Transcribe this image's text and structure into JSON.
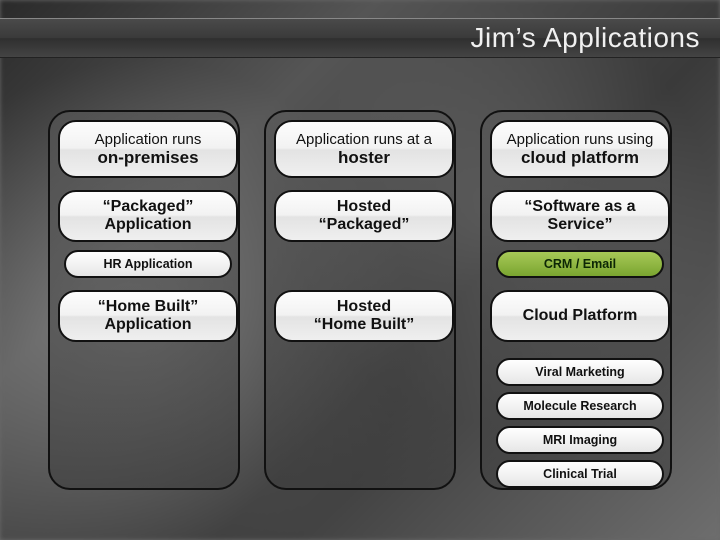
{
  "title": "Jim’s Applications",
  "columns": [
    {
      "header_line1": "Application runs",
      "header_line2": "on-premises",
      "row2_line1": "“Packaged”",
      "row2_line2": "Application",
      "pill1": "HR Application",
      "row3_line1": "“Home Built”",
      "row3_line2": "Application"
    },
    {
      "header_line1": "Application runs at a",
      "header_line2": "hoster",
      "row2_line1": "Hosted",
      "row2_line2": "“Packaged”",
      "row3_line1": "Hosted",
      "row3_line2": "“Home Built”"
    },
    {
      "header_line1": "Application runs using",
      "header_line2": "cloud platform",
      "row2_line1": "“Software as a",
      "row2_line2": "Service”",
      "pill1": "CRM / Email",
      "row3_line1": "Cloud Platform",
      "row3_line2": "",
      "pills_extra": [
        "Viral Marketing",
        "Molecule Research",
        "MRI Imaging",
        "Clinical Trial"
      ]
    }
  ]
}
